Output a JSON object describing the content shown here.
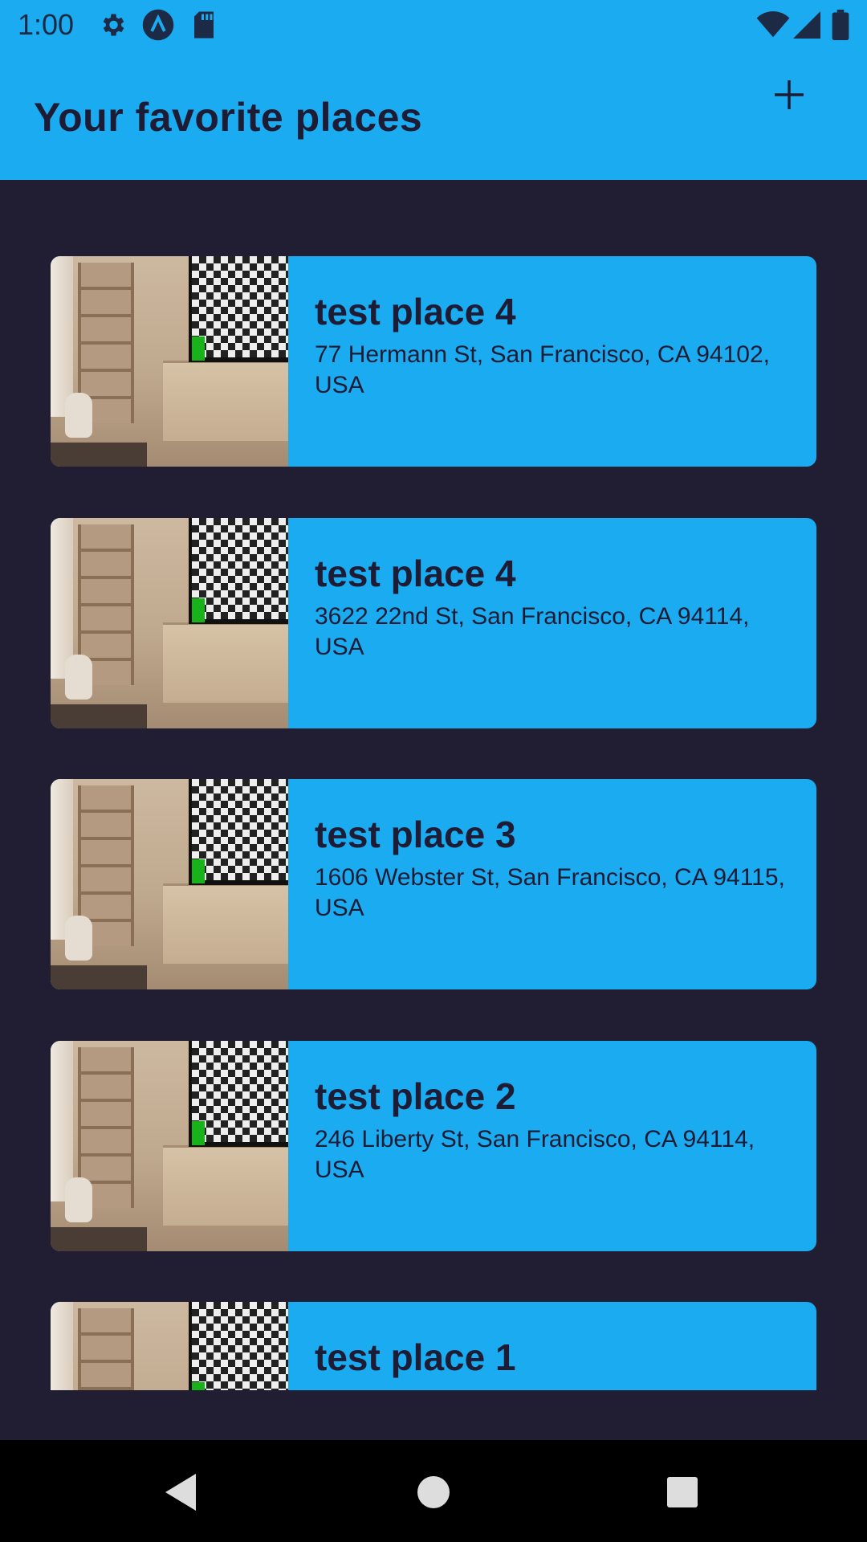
{
  "status_bar": {
    "time": "1:00",
    "left_icons": [
      "gear-icon",
      "app-a-icon",
      "sd-card-icon"
    ],
    "right_icons": [
      "wifi-icon",
      "cell-signal-icon",
      "battery-icon"
    ]
  },
  "app_bar": {
    "title": "Your favorite places",
    "add_icon": "plus-icon"
  },
  "places": [
    {
      "title": "test place 4",
      "address": "77 Hermann St, San Francisco, CA 94102, USA"
    },
    {
      "title": "test place 4",
      "address": "3622 22nd St, San Francisco, CA 94114, USA"
    },
    {
      "title": "test place 3",
      "address": "1606 Webster St, San Francisco, CA 94115, USA"
    },
    {
      "title": "test place 2",
      "address": "246 Liberty St, San Francisco, CA 94114, USA"
    },
    {
      "title": "test place 1",
      "address": ""
    }
  ],
  "nav_bar": {
    "buttons": [
      "back-icon",
      "home-icon",
      "recents-icon"
    ]
  },
  "colors": {
    "accent": "#1aabf0",
    "background": "#211d33",
    "text": "#1e1c35"
  }
}
